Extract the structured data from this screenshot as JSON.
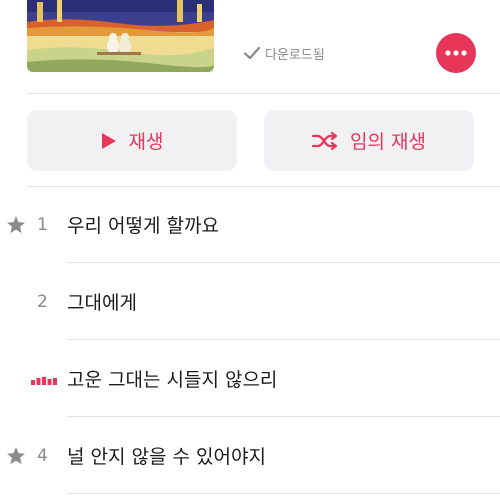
{
  "album": {
    "download_status": "다운로드됨",
    "download_icon": "checkmark-icon",
    "more_icon": "ellipsis-icon"
  },
  "actions": {
    "play_label": "재생",
    "play_icon": "play-icon",
    "shuffle_label": "임의 재생",
    "shuffle_icon": "shuffle-icon"
  },
  "tracks": [
    {
      "number": "1",
      "title": "우리 어떻게 할까요",
      "starred": true,
      "playing": false
    },
    {
      "number": "2",
      "title": "그대에게",
      "starred": false,
      "playing": false
    },
    {
      "number": "",
      "title": "고운 그대는 시들지 않으리",
      "starred": false,
      "playing": true
    },
    {
      "number": "4",
      "title": "널 안지 않을 수 있어야지",
      "starred": true,
      "playing": false
    }
  ],
  "colors": {
    "accent": "#e8365a",
    "button_bg": "#f1f1f4",
    "secondary_text": "#8a8a8e",
    "divider": "#e3e3e6",
    "star": "#8a8a8e"
  }
}
